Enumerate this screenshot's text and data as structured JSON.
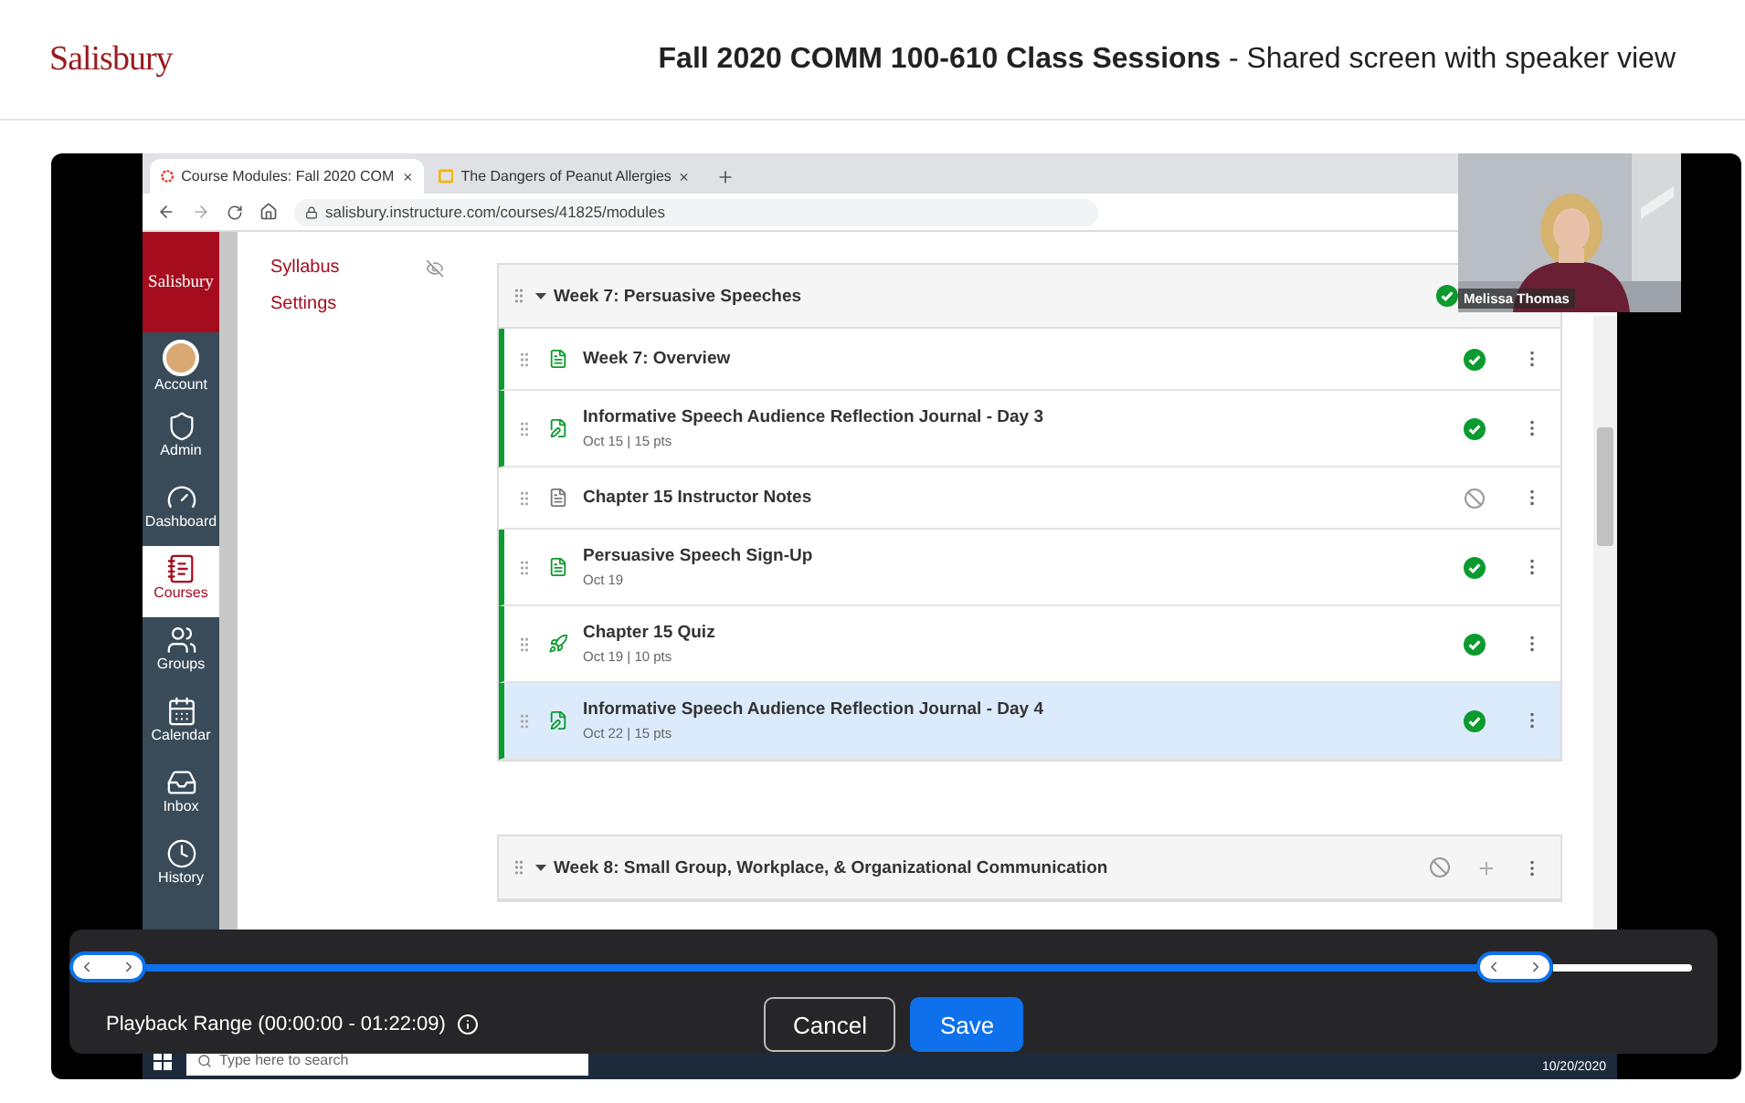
{
  "header": {
    "logo": "Salisbury",
    "title": "**Fall 2020 COMM 100-610 Class Sessions** - Shared screen with speaker view"
  },
  "browser": {
    "tabs": [
      {
        "title": "Course Modules: Fall 2020 COM",
        "selected": true,
        "kind": "canvas"
      },
      {
        "title": "The Dangers of Peanut Allergies",
        "selected": false,
        "kind": "slides"
      }
    ],
    "url": "salisbury.instructure.com/courses/41825/modules"
  },
  "global_nav": {
    "logo": "Salisbury",
    "items": [
      {
        "label": "Account",
        "kind": "account",
        "selected": false
      },
      {
        "label": "Admin",
        "kind": "admin",
        "selected": false
      },
      {
        "label": "Dashboard",
        "kind": "dashboard",
        "selected": false
      },
      {
        "label": "Courses",
        "kind": "courses",
        "selected": true
      },
      {
        "label": "Groups",
        "kind": "groups",
        "selected": false
      },
      {
        "label": "Calendar",
        "kind": "calendar",
        "selected": false
      },
      {
        "label": "Inbox",
        "kind": "inbox",
        "selected": false
      },
      {
        "label": "History",
        "kind": "history",
        "selected": false
      }
    ]
  },
  "course_nav": [
    {
      "label": "Syllabus",
      "hidden": true
    },
    {
      "label": "Settings",
      "hidden": false
    }
  ],
  "modules": [
    {
      "title": "Week 7: Persuasive Speeches",
      "published": true,
      "items": [
        {
          "title": "Week 7: Overview",
          "kind": "page",
          "published": true,
          "selected": false
        },
        {
          "title": "Informative Speech Audience Reflection Journal - Day 3",
          "kind": "assignment",
          "meta": "Oct 15 | 15 pts",
          "published": true,
          "selected": false
        },
        {
          "title": "Chapter 15 Instructor Notes",
          "kind": "page",
          "published": false,
          "selected": false
        },
        {
          "title": "Persuasive Speech Sign-Up",
          "kind": "page",
          "meta": "Oct 19",
          "published": true,
          "selected": false
        },
        {
          "title": "Chapter 15 Quiz",
          "kind": "quiz",
          "meta": "Oct 19 | 10 pts",
          "published": true,
          "selected": false
        },
        {
          "title": "Informative Speech Audience Reflection Journal - Day 4",
          "kind": "assignment",
          "meta": "Oct 22 | 15 pts",
          "published": true,
          "selected": true
        }
      ]
    },
    {
      "title": "Week 8: Small Group, Workplace, & Organizational Communication",
      "published": false
    }
  ],
  "taskbar": {
    "search_placeholder": "Type here to search",
    "date": "10/20/2020"
  },
  "speaker": {
    "name": "Melissa Thomas"
  },
  "playback": {
    "label": "Playback Range (00:00:00 - 01:22:09)",
    "start": {
      "level": 0
    },
    "end": {
      "level": 0.91
    },
    "buttons": [
      {
        "label": "Cancel",
        "kind": "secondary"
      },
      {
        "label": "Save",
        "kind": "primary"
      }
    ]
  }
}
